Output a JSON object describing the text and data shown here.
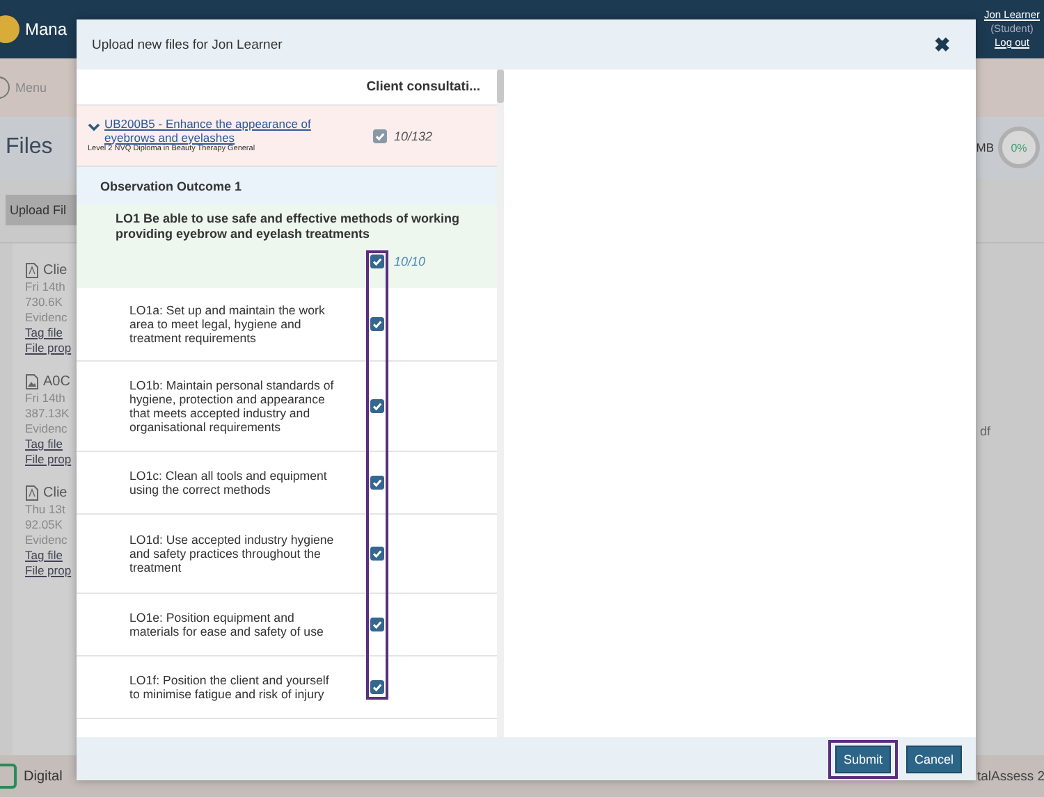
{
  "app": {
    "logo_text": "Mana",
    "user": {
      "name": "Jon Learner",
      "role": "(Student)",
      "logout": "Log out"
    },
    "menu": "Menu",
    "page_title": "Files",
    "storage": {
      "unit": "MB",
      "percent": "0%"
    },
    "upload_button": "Upload Fil",
    "files": [
      {
        "kind": "pdf",
        "name": "Clie",
        "lines": [
          "Fri 14th",
          "730.6K",
          "Evidenc"
        ],
        "tag": "Tag file",
        "props": "File prop"
      },
      {
        "kind": "image",
        "name": "A0C",
        "lines": [
          "Fri 14th",
          "387.13K",
          "Evidenc"
        ],
        "tag": "Tag file",
        "props": "File prop"
      },
      {
        "kind": "pdf",
        "name": "Clie",
        "lines": [
          "Thu 13t",
          "92.05K",
          "Evidenc"
        ],
        "tag": "Tag file",
        "props": "File prop"
      }
    ],
    "side_text": "df",
    "footer": {
      "left": "Digital",
      "right": "talAssess 2"
    }
  },
  "dialog": {
    "title": "Upload new files for Jon Learner",
    "close": "✖",
    "column_header": "Client consultati...",
    "unit": {
      "expanded": true,
      "link": "UB200B5 - Enhance the appearance of eyebrows and eyelashes",
      "subtitle": "Level 2 NVQ Diploma in Beauty Therapy General",
      "checked": true,
      "count": "10/132"
    },
    "section": "Observation Outcome 1",
    "outcome": {
      "text": "LO1 Be able to use safe and effective methods of working providing eyebrow and eyelash treatments",
      "checked": true,
      "count": "10/10"
    },
    "criteria": [
      {
        "text": "LO1a: Set up and maintain the work area to meet legal, hygiene and treatment requirements",
        "checked": true
      },
      {
        "text": "LO1b: Maintain personal standards of hygiene, protection and appearance that meets accepted industry and organisational requirements",
        "checked": true
      },
      {
        "text": "LO1c: Clean all tools and equipment using the correct methods",
        "checked": true
      },
      {
        "text": "LO1d: Use accepted industry hygiene and safety practices throughout the treatment",
        "checked": true
      },
      {
        "text": "LO1e: Position equipment and materials for ease and safety of use",
        "checked": true
      },
      {
        "text": "LO1f: Position the client and yourself to minimise fatigue and risk of injury",
        "checked": true
      }
    ],
    "buttons": [
      {
        "label": "Submit",
        "highlighted": true
      },
      {
        "label": "Cancel",
        "highlighted": false
      }
    ]
  }
}
